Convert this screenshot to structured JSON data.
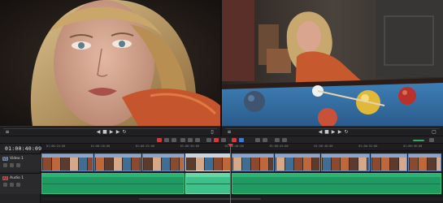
{
  "timeline": {
    "timecode": "01:00:40:09",
    "video_track_label": "Video 1",
    "video_track_tag": "V1",
    "audio_track_label": "Audio 1",
    "audio_track_tag": "A1",
    "ruler_ticks": [
      "01:00:24:00",
      "01:00:28:00",
      "01:00:32:00",
      "01:00:36:00",
      "01:00:40:00",
      "01:00:44:00",
      "01:00:48:00",
      "01:00:52:00",
      "01:00:56:00"
    ]
  },
  "colors": {
    "playhead": "#e23c3c",
    "audio_clip": "#1f9b62",
    "video_clip_border": "#6a8ab7",
    "accent_blue": "#3b7bd8"
  },
  "icons": {
    "transport": [
      "rewind-icon",
      "stop-icon",
      "play-icon",
      "fast-forward-icon",
      "loop-icon"
    ],
    "toolbar": [
      "selection-tool-icon",
      "trim-tool-icon",
      "blade-tool-icon",
      "snap-icon",
      "link-icon",
      "flag-icon",
      "marker-icon",
      "zoom-icon"
    ]
  }
}
